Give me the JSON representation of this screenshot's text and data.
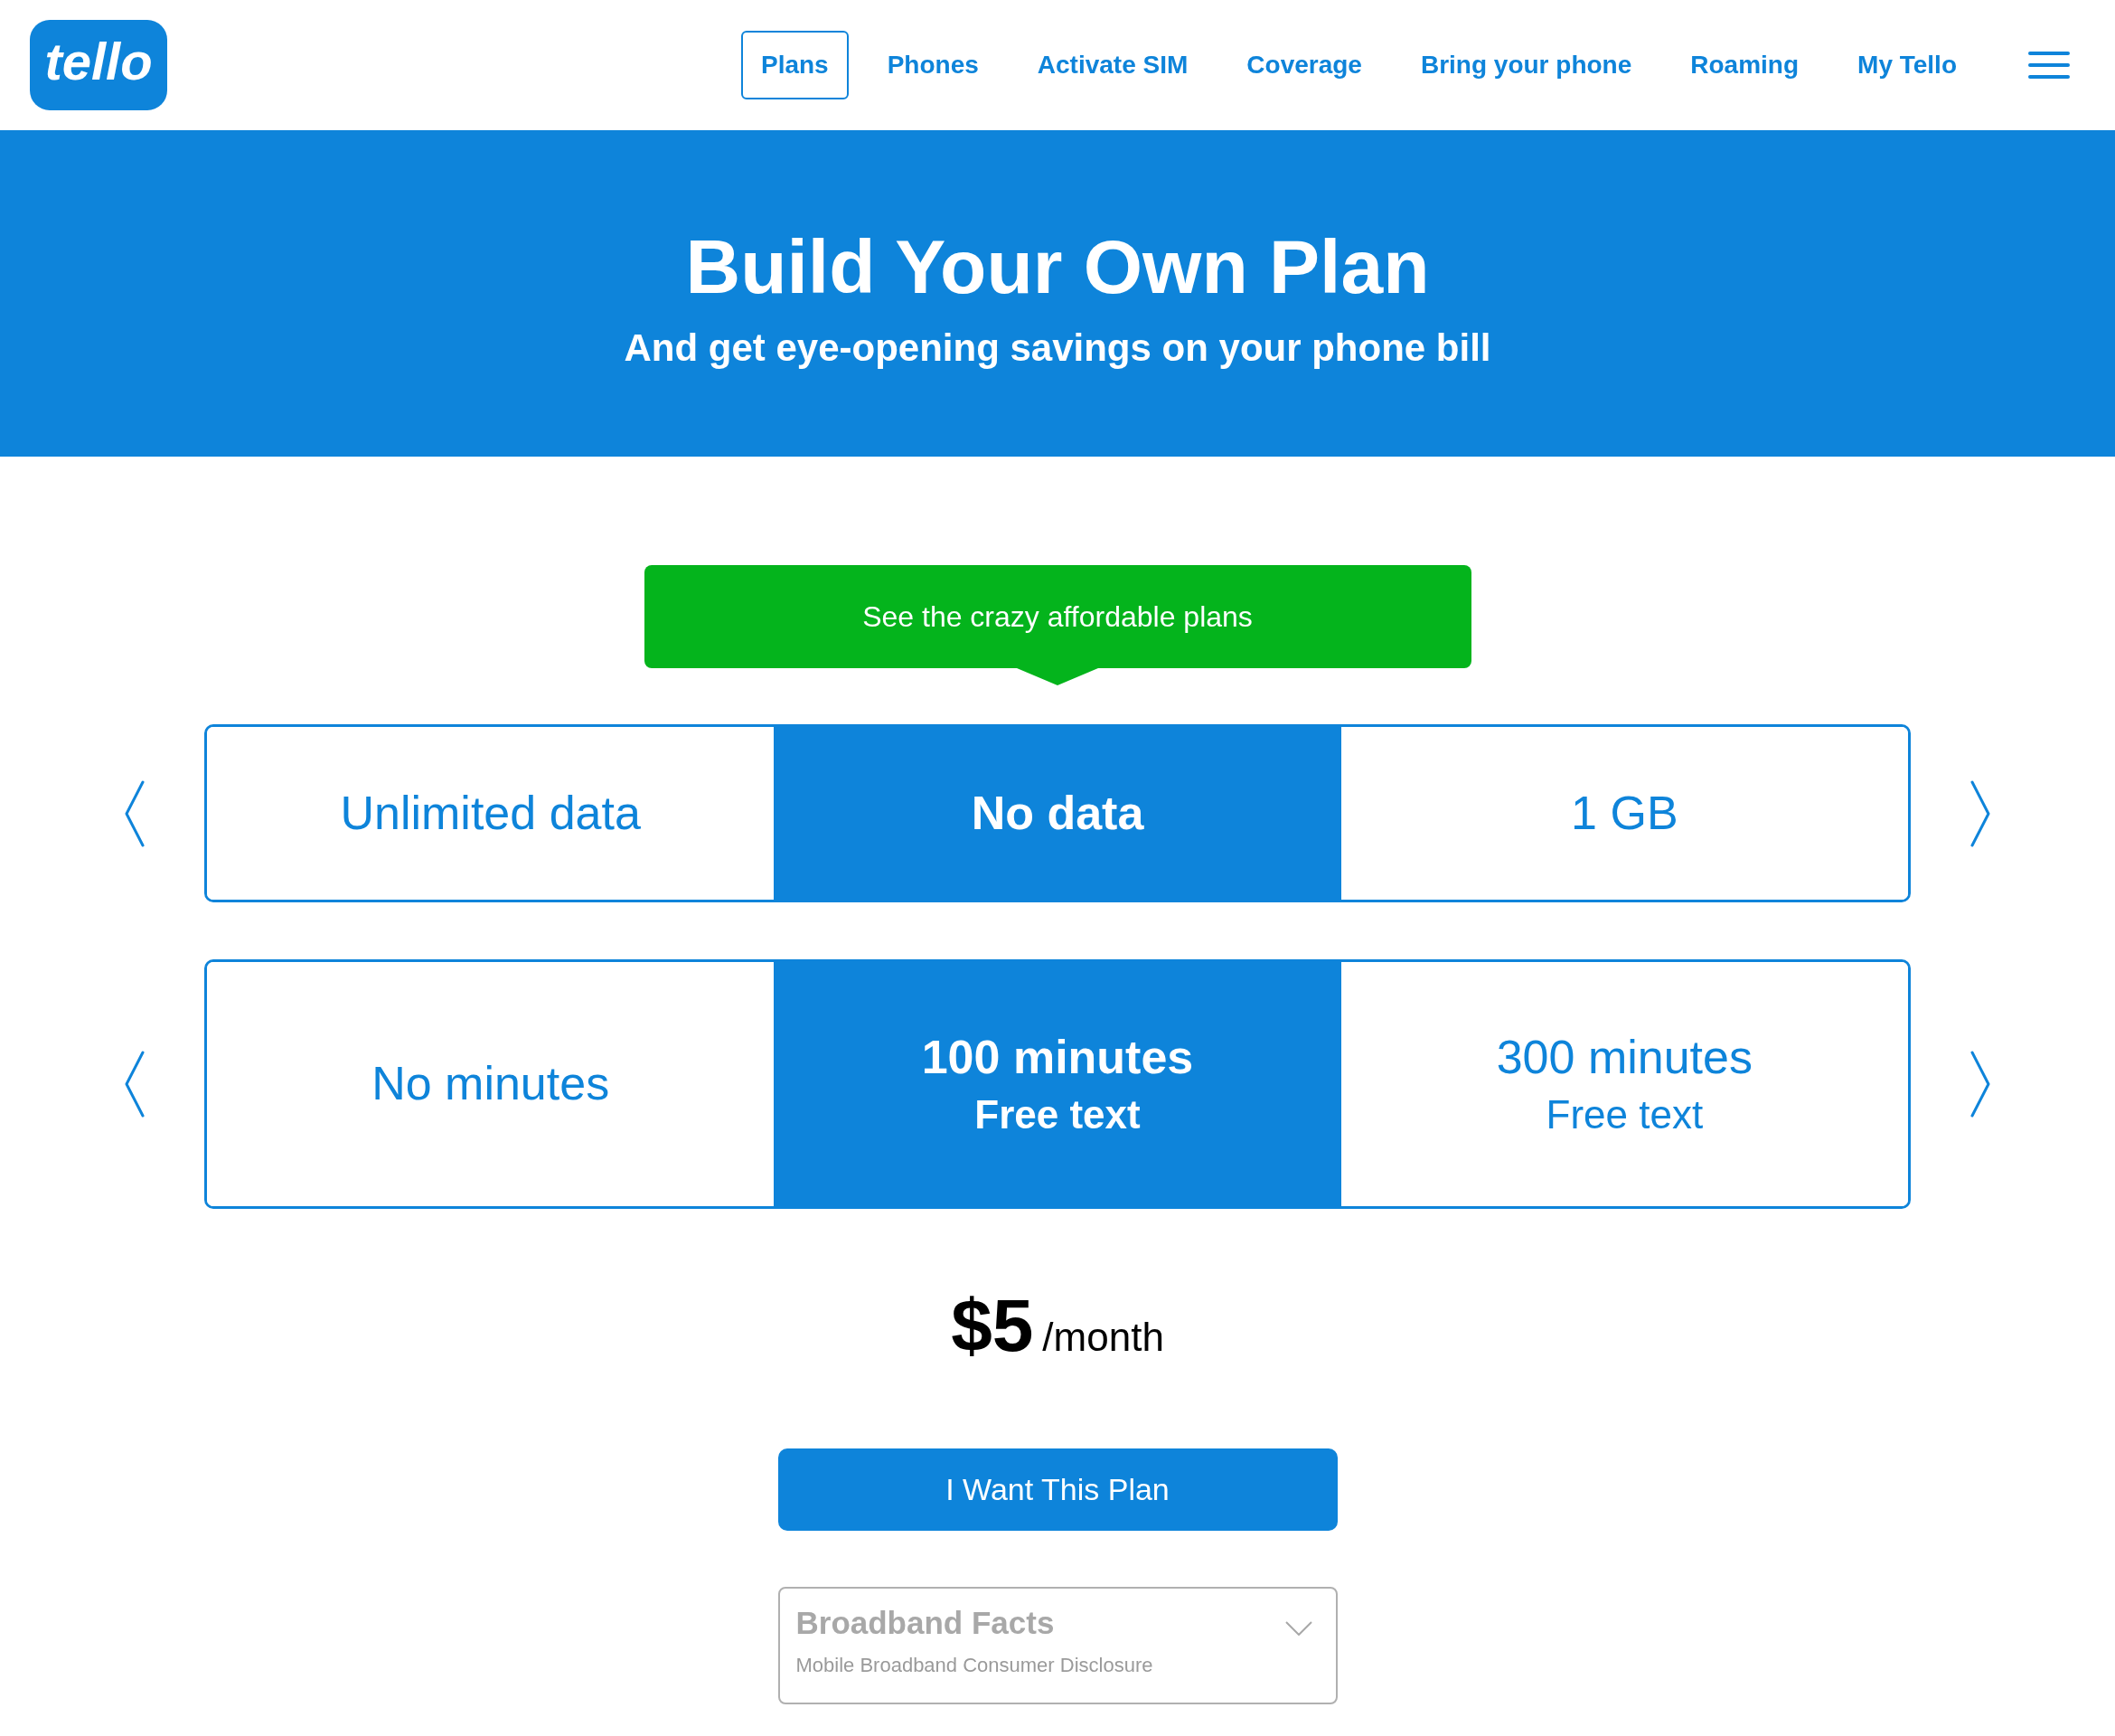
{
  "header": {
    "logo": "tello",
    "nav": [
      {
        "label": "Plans",
        "selected": true
      },
      {
        "label": "Phones",
        "selected": false
      },
      {
        "label": "Activate SIM",
        "selected": false
      },
      {
        "label": "Coverage",
        "selected": false
      },
      {
        "label": "Bring your phone",
        "selected": false
      },
      {
        "label": "Roaming",
        "selected": false
      },
      {
        "label": "My Tello",
        "selected": false
      }
    ]
  },
  "banner": {
    "title": "Build Your Own Plan",
    "subtitle": "And get eye-opening savings on your phone bill"
  },
  "callout": "See the crazy affordable plans",
  "selectors": [
    {
      "options": [
        {
          "label": "Unlimited data",
          "selected": false
        },
        {
          "label": "No data",
          "selected": true
        },
        {
          "label": "1 GB",
          "selected": false
        }
      ]
    },
    {
      "options": [
        {
          "label": "No minutes",
          "selected": false
        },
        {
          "label": "100 minutes",
          "note": "Free text",
          "selected": true
        },
        {
          "label": "300 minutes",
          "note": "Free text",
          "selected": false
        }
      ]
    }
  ],
  "price": {
    "amount": "$5",
    "period": "/month"
  },
  "cta": "I Want This Plan",
  "broadband_facts": {
    "title": "Broadband Facts",
    "subtitle": "Mobile Broadband Consumer Disclosure",
    "expanded": false
  }
}
